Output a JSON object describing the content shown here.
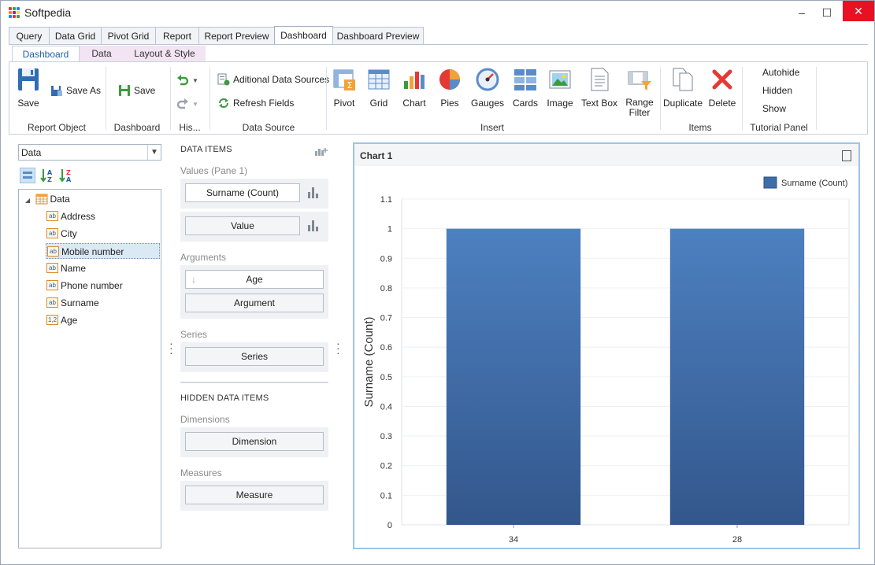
{
  "app": {
    "title": "Softpedia"
  },
  "main_tabs": [
    "Query",
    "Data Grid",
    "Pivot Grid",
    "Report",
    "Report Preview",
    "Dashboard",
    "Dashboard Preview"
  ],
  "ribbon_tabs": [
    "Dashboard",
    "Data",
    "Layout & Style"
  ],
  "ribbon": {
    "report_object": {
      "label": "Report Object",
      "save": "Save",
      "save_as": "Save As"
    },
    "dashboard": {
      "label": "Dashboard",
      "save": "Save"
    },
    "history": {
      "label": "His..."
    },
    "data_source": {
      "label": "Data Source",
      "additional": "Aditional Data Sources",
      "refresh": "Refresh Fields"
    },
    "insert": {
      "label": "Insert",
      "items": [
        "Pivot",
        "Grid",
        "Chart",
        "Pies",
        "Gauges",
        "Cards",
        "Image",
        "Text Box",
        "Range\nFilter"
      ]
    },
    "items": {
      "label": "Items",
      "duplicate": "Duplicate",
      "delete": "Delete"
    },
    "tutorial": {
      "label": "Tutorial Panel",
      "autohide": "Autohide",
      "hidden": "Hidden",
      "show": "Show"
    }
  },
  "left": {
    "datasource_value": "Data",
    "tree_root": "Data",
    "fields": [
      {
        "name": "Address",
        "type": "ab"
      },
      {
        "name": "City",
        "type": "ab"
      },
      {
        "name": "Mobile number",
        "type": "ab"
      },
      {
        "name": "Name",
        "type": "ab"
      },
      {
        "name": "Phone number",
        "type": "ab"
      },
      {
        "name": "Surname",
        "type": "ab"
      },
      {
        "name": "Age",
        "type": "1,2"
      }
    ],
    "selected_field": "Mobile number"
  },
  "data_items": {
    "title": "DATA ITEMS",
    "values_label": "Values (Pane 1)",
    "values": [
      "Surname (Count)",
      "Value"
    ],
    "arguments_label": "Arguments",
    "arguments": [
      "Age",
      "Argument"
    ],
    "series_label": "Series",
    "series": [
      "Series"
    ],
    "hidden_title": "HIDDEN DATA ITEMS",
    "dimensions_label": "Dimensions",
    "dimensions": [
      "Dimension"
    ],
    "measures_label": "Measures",
    "measures": [
      "Measure"
    ]
  },
  "chart": {
    "panel_title": "Chart 1"
  },
  "colors": {
    "bar": "#3f6da9",
    "accent": "#1e5fa8",
    "panel_border": "#9ec3e6"
  },
  "chart_data": {
    "type": "bar",
    "categories": [
      "34",
      "28"
    ],
    "series": [
      {
        "name": "Surname (Count)",
        "values": [
          1,
          1
        ]
      }
    ],
    "ylabel": "Surname (Count)",
    "ylim": [
      0,
      1.1
    ],
    "y_ticks": [
      "0",
      "0.1",
      "0.2",
      "0.3",
      "0.4",
      "0.5",
      "0.6",
      "0.7",
      "0.8",
      "0.9",
      "1",
      "1.1"
    ],
    "grid": true,
    "legend": "top-right"
  }
}
